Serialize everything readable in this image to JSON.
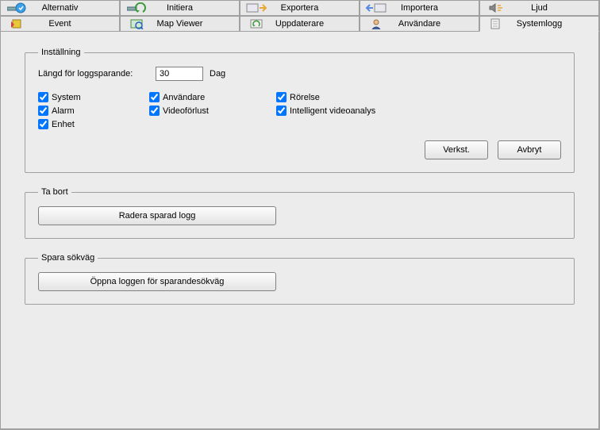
{
  "tabs_row1": [
    {
      "label": "Alternativ",
      "icon": "options-icon"
    },
    {
      "label": "Initiera",
      "icon": "initiate-icon"
    },
    {
      "label": "Exportera",
      "icon": "export-icon"
    },
    {
      "label": "Importera",
      "icon": "import-icon"
    },
    {
      "label": "Ljud",
      "icon": "sound-icon"
    }
  ],
  "tabs_row2": [
    {
      "label": "Event",
      "icon": "event-icon"
    },
    {
      "label": "Map Viewer",
      "icon": "map-icon"
    },
    {
      "label": "Uppdaterare",
      "icon": "updater-icon"
    },
    {
      "label": "Användare",
      "icon": "user-icon"
    },
    {
      "label": "Systemlogg",
      "icon": "log-icon",
      "active": true
    }
  ],
  "settings": {
    "legend": "Inställning",
    "length_label": "Längd för loggsparande:",
    "length_value": "30",
    "length_unit": "Dag",
    "checks": {
      "system": "System",
      "user": "Användare",
      "motion": "Rörelse",
      "alarm": "Alarm",
      "videoloss": "Videoförlust",
      "iva": "Intelligent videoanalys",
      "device": "Enhet"
    },
    "apply": "Verkst.",
    "cancel": "Avbryt"
  },
  "delete": {
    "legend": "Ta bort",
    "button": "Radera sparad logg"
  },
  "savepath": {
    "legend": "Spara sökväg",
    "button": "Öppna loggen för sparandesökväg"
  }
}
